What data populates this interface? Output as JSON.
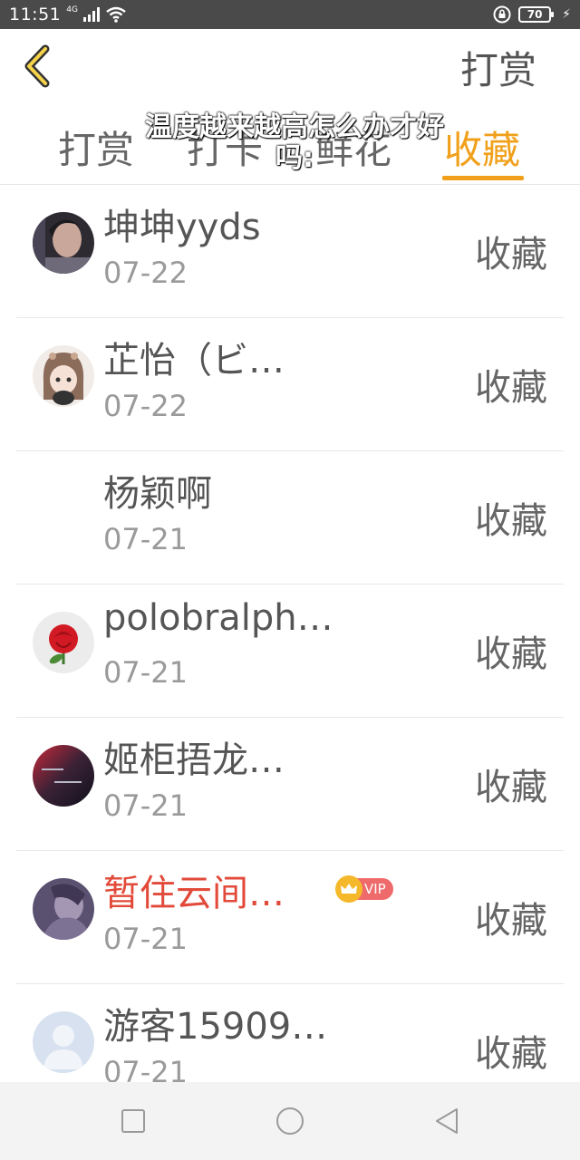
{
  "status": {
    "time": "11:51",
    "network": "4G",
    "battery": "70"
  },
  "header": {
    "right_label": "打赏"
  },
  "tabs": [
    {
      "label": "打赏"
    },
    {
      "label": "打卡"
    },
    {
      "label": "鲜花"
    },
    {
      "label": "收藏"
    }
  ],
  "toast": {
    "text": "温度越来越高怎么办才好吗:"
  },
  "colors": {
    "accent": "#f0a01a",
    "vip_name": "#e24a3a"
  },
  "list": [
    {
      "name": "坤坤yyds",
      "date": "07-22",
      "action": "收藏",
      "avatar": "dark-photo"
    },
    {
      "name": "芷怡（ビ…",
      "date": "07-22",
      "action": "收藏",
      "avatar": "anime-girl"
    },
    {
      "name": "杨颖啊",
      "date": "07-21",
      "action": "收藏",
      "avatar": "none"
    },
    {
      "name": "polobralph…",
      "date": "07-21",
      "action": "收藏",
      "avatar": "rose"
    },
    {
      "name": "姬柜捂龙…",
      "date": "07-21",
      "action": "收藏",
      "avatar": "dark-text"
    },
    {
      "name": "暂住云间…",
      "date": "07-21",
      "action": "收藏",
      "avatar": "purple",
      "vip": "VIP"
    },
    {
      "name": "游客15909…",
      "date": "07-21",
      "action": "收藏",
      "avatar": "default-user"
    }
  ]
}
